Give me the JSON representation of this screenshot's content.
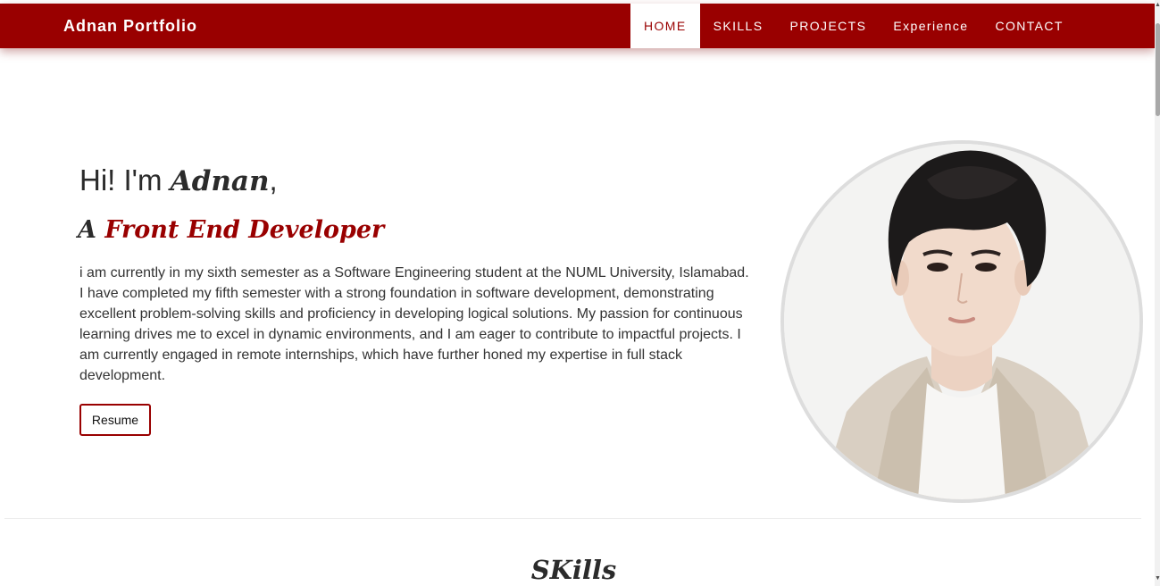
{
  "navbar": {
    "brand": "Adnan Portfolio",
    "items": [
      {
        "label": "HOME",
        "active": true
      },
      {
        "label": "SKILLS",
        "active": false
      },
      {
        "label": "PROJECTS",
        "active": false
      },
      {
        "label": "Experience",
        "active": false
      },
      {
        "label": "CONTACT",
        "active": false
      }
    ]
  },
  "hero": {
    "greeting_prefix": "Hi! I'm ",
    "name": "Adnan",
    "greeting_suffix": ",",
    "role_prefix": "A ",
    "role": "Front End Developer",
    "bio": "i am currently in my sixth semester as a Software Engineering student at the NUML University, Islamabad. I have completed my fifth semester with a strong foundation in software development, demonstrating excellent problem-solving skills and proficiency in developing logical solutions. My passion for continuous learning drives me to excel in dynamic environments, and I am eager to contribute to impactful projects. I am currently engaged in remote internships, which have further honed my expertise in full stack development.",
    "resume_label": "Resume",
    "photo_icon": "profile-photo"
  },
  "skills": {
    "title": "SKills"
  },
  "colors": {
    "brand": "#990000",
    "text": "#2b2b2b",
    "background": "#ffffff"
  }
}
